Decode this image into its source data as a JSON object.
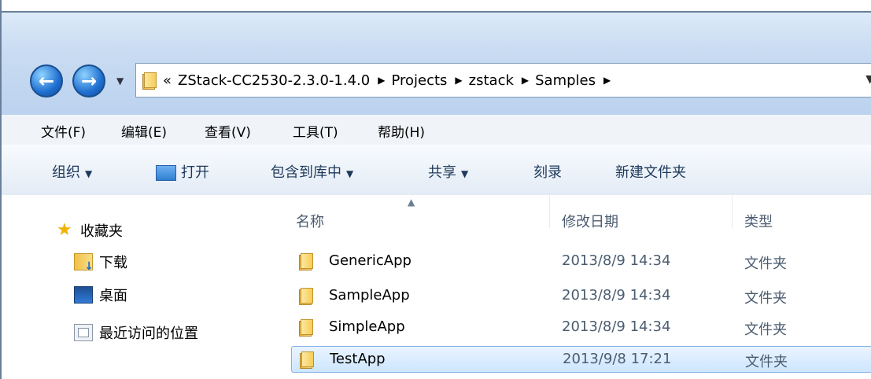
{
  "address": {
    "overflow": "«",
    "crumbs": [
      "ZStack-CC2530-2.3.0-1.4.0",
      "Projects",
      "zstack",
      "Samples"
    ]
  },
  "menu": [
    "文件(F)",
    "编辑(E)",
    "查看(V)",
    "工具(T)",
    "帮助(H)"
  ],
  "toolbar": {
    "organize": "组织",
    "open": "打开",
    "include_library": "包含到库中",
    "share": "共享",
    "burn": "刻录",
    "new_folder": "新建文件夹"
  },
  "sidebar": {
    "favorites": "收藏夹",
    "items": [
      "下载",
      "桌面",
      "最近访问的位置"
    ]
  },
  "columns": {
    "name": "名称",
    "date": "修改日期",
    "type": "类型"
  },
  "files": [
    {
      "name": "GenericApp",
      "date": "2013/8/9 14:34",
      "type": "文件夹"
    },
    {
      "name": "SampleApp",
      "date": "2013/8/9 14:34",
      "type": "文件夹"
    },
    {
      "name": "SimpleApp",
      "date": "2013/8/9 14:34",
      "type": "文件夹"
    },
    {
      "name": "TestApp",
      "date": "2013/9/8 17:21",
      "type": "文件夹"
    }
  ],
  "selected_file": "TestApp"
}
